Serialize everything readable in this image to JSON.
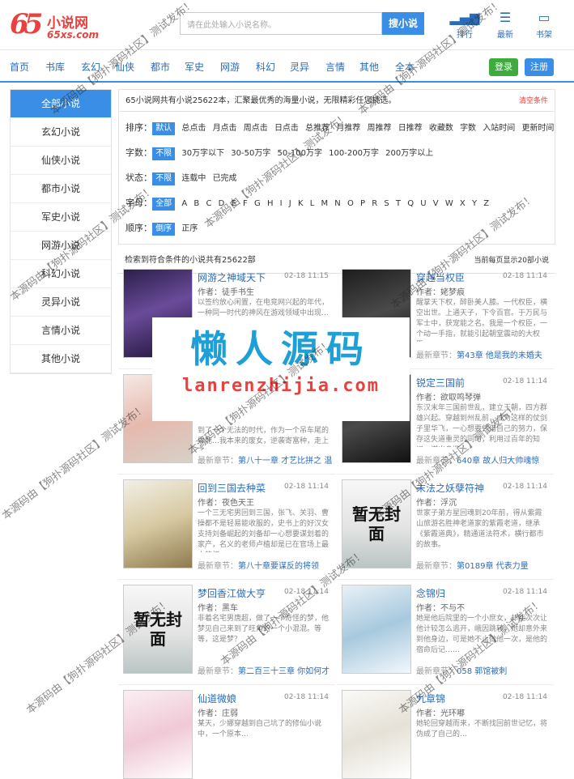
{
  "header": {
    "logo_num": "65",
    "logo_cn": "小说网",
    "logo_en": "65xs.com",
    "search_placeholder": "请在此处输入小说名称。",
    "search_button": "搜小说",
    "icons": [
      {
        "name": "ranking-icon",
        "glyph": "▂▄▆",
        "label": "排行"
      },
      {
        "name": "latest-icon",
        "glyph": "☰",
        "label": "最新"
      },
      {
        "name": "bookshelf-icon",
        "glyph": "▭",
        "label": "书架"
      }
    ]
  },
  "nav": {
    "items": [
      "首页",
      "书库",
      "玄幻",
      "仙侠",
      "都市",
      "军史",
      "网游",
      "科幻",
      "灵异",
      "言情",
      "其他",
      "全本"
    ],
    "login": "登录",
    "register": "注册"
  },
  "sidebar": {
    "items": [
      "全部小说",
      "玄幻小说",
      "仙侠小说",
      "都市小说",
      "军史小说",
      "网游小说",
      "科幻小说",
      "灵异小说",
      "言情小说",
      "其他小说"
    ]
  },
  "filters": {
    "notice": "65小说网共有小说25622本，汇聚最优秀的海量小说，无限精彩任您挑选。",
    "clear": "清空条件",
    "rows": [
      {
        "label": "排序：",
        "options": [
          "默认",
          "总点击",
          "月点击",
          "周点击",
          "日点击",
          "总推荐",
          "月推荐",
          "周推荐",
          "日推荐",
          "收藏数",
          "字数",
          "入站时间",
          "更新时间"
        ]
      },
      {
        "label": "字数：",
        "options": [
          "不限",
          "30万字以下",
          "30-50万字",
          "50-100万字",
          "100-200万字",
          "200万字以上"
        ]
      },
      {
        "label": "状态：",
        "options": [
          "不限",
          "连载中",
          "已完成"
        ]
      },
      {
        "label": "字母：",
        "options": [
          "全部",
          "A",
          "B",
          "C",
          "D",
          "E",
          "F",
          "G",
          "H",
          "I",
          "J",
          "K",
          "L",
          "M",
          "N",
          "O",
          "P",
          "R",
          "S",
          "T",
          "Q",
          "U",
          "V",
          "W",
          "X",
          "Y",
          "Z"
        ]
      },
      {
        "label": "顺序：",
        "options": [
          "倒序",
          "正序"
        ]
      }
    ]
  },
  "results": {
    "left": "检索到符合条件的小说共有25622部",
    "right": "当前每页显示20部小说"
  },
  "books": [
    {
      "title": "网游之神域天下",
      "date": "02-18 11:15",
      "author": "作者：徒手书生",
      "desc": "以签约放心闲置，在电竞网兴起的年代，一种同一时代的神风在游戏领域中出现…",
      "latest_label": "最新章节：",
      "latest": "",
      "cover": "c1",
      "cover_text": ""
    },
    {
      "title": "穿越当权臣",
      "date": "02-18 11:14",
      "author": "作者：姥梦痕",
      "desc": "醒掌天下权，醉卧美人膝。一代权臣，横空出世。上通天子，下令百官。于万民与军士中，获宠能之名。我是一个权臣，一个动一手指，就能引起朝堂震动的大权臣。",
      "latest_label": "最新章节：",
      "latest": "第43章 他是我的未婚夫",
      "cover": "c2",
      "cover_text": ""
    },
    {
      "title": "",
      "date": "",
      "author": "",
      "desc": "到了一个无法的时代，作为一个吊车尾的异能…我本来的废女，逆袭寄富种，走上了…",
      "latest_label": "最新章节：",
      "latest": "第八十一章 才艺比拼之 温",
      "cover": "c3",
      "cover_text": ""
    },
    {
      "title": "锐定三国前",
      "date": "02-18 11:14",
      "author": "作者：欲取鸣琴弹",
      "desc": "东汉末年三国前世乱，建立王朝，四方群雄兴起。穿越到州乱前，成为这样的仗剑子里华飞，一心想要凭借自己的努力，保存这失道重灵的同时，利用过百年的知识，谋出身揽人…",
      "latest_label": "最新章节：",
      "latest": "640章 故人归大帅魂惊",
      "cover": "c2",
      "cover_text": ""
    },
    {
      "title": "回到三国去种菜",
      "date": "02-18 11:14",
      "author": "作者：夜色天王",
      "desc": "一个三无宅男回到三国，张飞、关羽、曹操都不是轻易能收服的，史书上的好汉女支持刘备崛起的刘备却一心想要谋划着的家产，名义的老师卢植却是已在官场上最大的权…",
      "latest_label": "最新章节：",
      "latest": "第八十章要谋反的将领",
      "cover": "c4",
      "cover_text": ""
    },
    {
      "title": "末法之妖孽符神",
      "date": "02-18 11:14",
      "author": "作者：浮沉",
      "desc": "世家子弟方星回魂到20年前，得从紫霞山旅游名胜神老道家的紫霞老道，继承《紫霞道典》，精通道法符术，横行都市的故事。",
      "latest_label": "最新章节：",
      "latest": "第0189章 代表力量",
      "cover": "placeholder",
      "cover_text": "暂无封面"
    },
    {
      "title": "梦回香江做大亨",
      "date": "02-18 11:14",
      "author": "作者：黑车",
      "desc": "非着名宅男唐超，做了一个奇怪的梦，他梦见自己来到了旺角的一个小混混。等等，这是梦？",
      "latest_label": "最新章节：",
      "latest": "第二百三十三章 你如何才",
      "cover": "placeholder",
      "cover_text": "暂无封面"
    },
    {
      "title": "念锦归",
      "date": "02-18 11:14",
      "author": "作者：不与不",
      "desc": "她是他后院里的一个小庶女，却能次次让他计较怎么逃开，峨因跳转，她却意外来到他身边，可是她不止做他一次，是他的宿命后记……",
      "latest_label": "最新章节：",
      "latest": "058 郭馆被刺",
      "cover": "c5",
      "cover_text": ""
    },
    {
      "title": "仙道微娘",
      "date": "02-18 11:14",
      "author": "作者：庄弱",
      "desc": "某天，少娜穿越到自己坑了的修仙小说中，一个原本…",
      "latest_label": "最新章节：",
      "latest": "",
      "cover": "c6",
      "cover_text": ""
    },
    {
      "title": "九章锦",
      "date": "02-18 11:14",
      "author": "作者：光环嘟",
      "desc": "她轮回穿越而来，不断找回前世记忆，将伪成了自己的…",
      "latest_label": "最新章节：",
      "latest": "",
      "cover": "c7",
      "cover_text": ""
    }
  ],
  "watermark": {
    "line1": "懒人源码",
    "line2": "lanrenzhijia.com",
    "tile": "本源码由【狗扑源码社区】测试发布！"
  }
}
